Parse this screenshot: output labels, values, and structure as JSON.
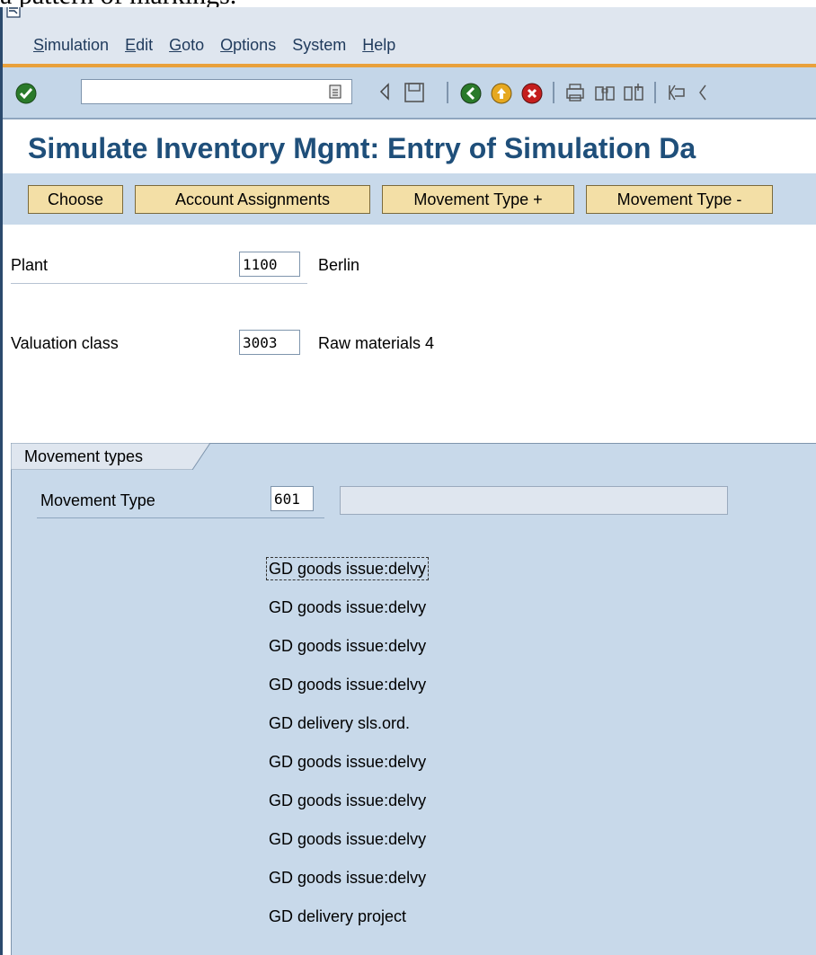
{
  "clipped_text": "a pattern of markings.",
  "menubar": {
    "items": [
      {
        "label": "Simulation",
        "mnemonic": "S",
        "rest": "imulation"
      },
      {
        "label": "Edit",
        "mnemonic": "E",
        "rest": "dit"
      },
      {
        "label": "Goto",
        "mnemonic": "G",
        "rest": "oto"
      },
      {
        "label": "Options",
        "mnemonic": "O",
        "rest": "ptions"
      },
      {
        "label": "System",
        "mnemonic": "",
        "rest": "System"
      },
      {
        "label": "Help",
        "mnemonic": "H",
        "rest": "elp"
      }
    ]
  },
  "toolbar": {
    "command_value": "",
    "icons": [
      "enter-icon",
      "dropdown-icon",
      "back-triangle-icon",
      "save-icon",
      "back-icon",
      "exit-icon",
      "cancel-icon",
      "print-icon",
      "find-icon",
      "find-next-icon",
      "first-page-icon"
    ]
  },
  "title": "Simulate Inventory Mgmt: Entry of Simulation Da",
  "app_toolbar": {
    "choose": "Choose",
    "account_assignments": "Account Assignments",
    "movement_type_plus": "Movement Type +",
    "movement_type_minus": "Movement Type -"
  },
  "form": {
    "plant_label": "Plant",
    "plant_value": "1100",
    "plant_desc": "Berlin",
    "valuation_label": "Valuation class",
    "valuation_value": "3003",
    "valuation_desc": "Raw materials 4"
  },
  "group": {
    "title": "Movement types",
    "movement_type_label": "Movement Type",
    "movement_type_value": "601",
    "movement_type_desc": "",
    "list": [
      "GD goods issue:delvy",
      "GD goods issue:delvy",
      "GD goods issue:delvy",
      "GD goods issue:delvy",
      "GD delivery sls.ord.",
      "GD goods issue:delvy",
      "GD goods issue:delvy",
      "GD goods issue:delvy",
      "GD goods issue:delvy",
      "GD delivery project"
    ]
  },
  "colors": {
    "title": "#1f4f7a",
    "menu_bg": "#dfe6ef",
    "accent_orange": "#e9a13b",
    "toolbar_bg": "#c4d6e8",
    "button_bg": "#f3dfa6",
    "group_bg": "#c8d9ea"
  }
}
